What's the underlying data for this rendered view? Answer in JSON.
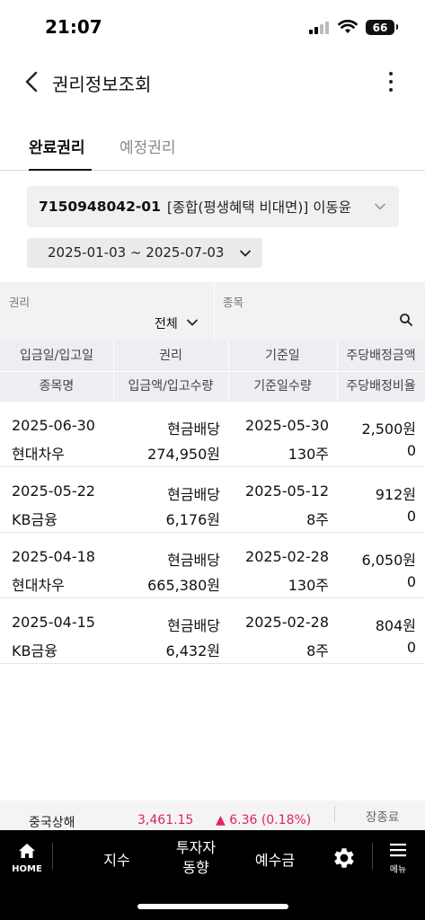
{
  "status_bar": {
    "time": "21:07",
    "battery": "66"
  },
  "header": {
    "title": "권리정보조회"
  },
  "tabs": [
    {
      "label": "완료권리"
    },
    {
      "label": "예정권리"
    }
  ],
  "account": {
    "number": "7150948042-01",
    "description": "[종합(평생혜택 비대면)] 이동윤"
  },
  "date_range": "2025-01-03 ~ 2025-07-03",
  "filters": {
    "rights_label": "권리",
    "rights_value": "전체",
    "stock_label": "종목"
  },
  "table_header": {
    "row1": [
      "입금일/입고일",
      "권리",
      "기준일",
      "주당배정금액"
    ],
    "row2": [
      "종목명",
      "입금액/입고수량",
      "기준일수량",
      "주당배정비율"
    ]
  },
  "rows": [
    {
      "date": "2025-06-30",
      "name": "현대차우",
      "type": "현금배당",
      "amount": "274,950원",
      "base_date": "2025-05-30",
      "base_qty": "130주",
      "dividend": "2,500원",
      "ratio": "0"
    },
    {
      "date": "2025-05-22",
      "name": "KB금융",
      "type": "현금배당",
      "amount": "6,176원",
      "base_date": "2025-05-12",
      "base_qty": "8주",
      "dividend": "912원",
      "ratio": "0"
    },
    {
      "date": "2025-04-18",
      "name": "현대차우",
      "type": "현금배당",
      "amount": "665,380원",
      "base_date": "2025-02-28",
      "base_qty": "130주",
      "dividend": "6,050원",
      "ratio": "0"
    },
    {
      "date": "2025-04-15",
      "name": "KB금융",
      "type": "현금배당",
      "amount": "6,432원",
      "base_date": "2025-02-28",
      "base_qty": "8주",
      "dividend": "804원",
      "ratio": "0"
    }
  ],
  "ticker": {
    "name": "중국상해",
    "price": "3,461.15",
    "change": "▲ 6.36 (0.18%)",
    "status": "장종료",
    "up_color": "#e0245e"
  },
  "bottom_nav": {
    "home": "HOME",
    "index": "지수",
    "investor_line1": "투자자",
    "investor_line2": "동향",
    "deposit": "예수금",
    "menu": "메뉴"
  }
}
